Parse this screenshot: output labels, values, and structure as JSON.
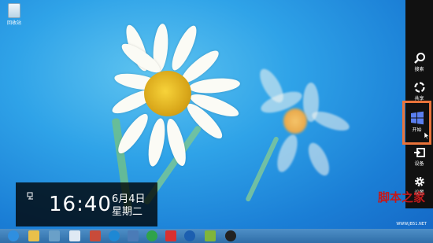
{
  "desktop": {
    "recycle_bin": {
      "label": "回收站",
      "icon": "recycle-bin-icon"
    }
  },
  "charms": [
    {
      "label": "搜索",
      "icon": "search-icon"
    },
    {
      "label": "共享",
      "icon": "share-icon"
    },
    {
      "label": "开始",
      "icon": "windows-start-icon",
      "highlighted": true
    },
    {
      "label": "设备",
      "icon": "devices-icon"
    },
    {
      "label": "设置",
      "icon": "gear-icon"
    }
  ],
  "clock": {
    "time": "16:40",
    "date": "6月4日",
    "weekday": "星期二",
    "icon": "network-icon"
  },
  "taskbar": {
    "items": [
      {
        "icon": "internet-explorer-icon",
        "color": "#2f8fe0"
      },
      {
        "icon": "file-explorer-icon",
        "color": "#e9c04a"
      },
      {
        "icon": "photo-viewer-icon",
        "color": "#6aa0c8"
      },
      {
        "icon": "qq-browser-icon",
        "color": "#dfe9f4"
      },
      {
        "icon": "app-icon",
        "color": "#c84b3a"
      },
      {
        "icon": "sogou-icon",
        "color": "#1e88d4"
      },
      {
        "icon": "screenshot-icon",
        "color": "#4a7bb7"
      },
      {
        "icon": "360-icon",
        "color": "#2fa34a"
      },
      {
        "icon": "red-app-icon",
        "color": "#d83030"
      },
      {
        "icon": "media-player-icon",
        "color": "#1c5fb0"
      },
      {
        "icon": "flag-icon",
        "color": "#7fb53a"
      },
      {
        "icon": "qq-penguin-icon",
        "color": "#222222"
      }
    ]
  },
  "watermark": {
    "title": "脚本之家",
    "url": "WWW.JB51.NET"
  },
  "colors": {
    "charm_highlight": "#e9733a",
    "charms_bg": "#111111",
    "taskbar": "#3b7db8"
  }
}
